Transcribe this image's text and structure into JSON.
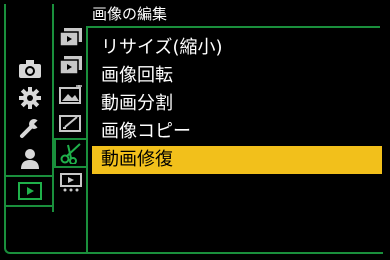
{
  "menu": {
    "title": "画像の編集",
    "items": [
      {
        "label": "リサイズ(縮小)",
        "selected": false
      },
      {
        "label": "画像回転",
        "selected": false
      },
      {
        "label": "動画分割",
        "selected": false
      },
      {
        "label": "画像コピー",
        "selected": false
      },
      {
        "label": "動画修復",
        "selected": true
      }
    ]
  },
  "categories": [
    {
      "icon": "camera-icon"
    },
    {
      "icon": "gear-icon"
    },
    {
      "icon": "wrench-icon"
    },
    {
      "icon": "person-icon"
    },
    {
      "icon": "playback-icon",
      "selected": true
    }
  ],
  "sub_tabs": [
    {
      "icon": "playback-mode-icon"
    },
    {
      "icon": "playback-process-icon"
    },
    {
      "icon": "add-edit-info-icon"
    },
    {
      "icon": "edit-text-icon"
    },
    {
      "icon": "edit-image-icon",
      "selected": true
    },
    {
      "icon": "others-icon"
    }
  ],
  "colors": {
    "accent_green": "#1a8f3c",
    "selection_yellow": "#f2c01b"
  }
}
